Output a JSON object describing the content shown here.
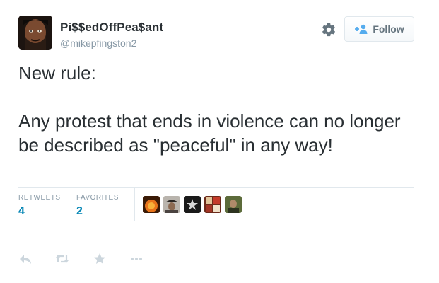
{
  "user": {
    "display_name": "Pi$$edOffPea$ant",
    "handle": "@mikepfingston2"
  },
  "header": {
    "follow_label": "Follow"
  },
  "tweet": {
    "text": "New rule:\n\nAny protest that ends in violence can no longer be described as \"peaceful\" in any way!"
  },
  "stats": {
    "retweets_label": "RETWEETS",
    "retweets_count": "4",
    "favorites_label": "FAVORITES",
    "favorites_count": "2"
  },
  "icons": {
    "settings": "gear-icon",
    "follow": "user-plus-icon",
    "reply": "reply-icon",
    "retweet": "retweet-icon",
    "favorite": "star-icon",
    "more": "more-icon"
  },
  "colors": {
    "link_blue": "#0084b4",
    "muted_text": "#8899a6",
    "border": "#e1e8ed",
    "action_icon": "#ccd6dd"
  }
}
